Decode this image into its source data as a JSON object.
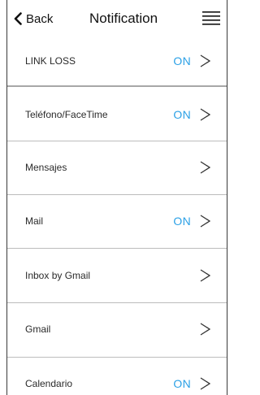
{
  "header": {
    "back_label": "Back",
    "title": "Notification",
    "back_icon": "chevron-left-icon",
    "menu_icon": "hamburger-menu-icon"
  },
  "items": [
    {
      "label": "LINK LOSS",
      "status": "ON"
    },
    {
      "label": "Teléfono/FaceTime",
      "status": "ON"
    },
    {
      "label": "Mensajes",
      "status": ""
    },
    {
      "label": "Mail",
      "status": "ON"
    },
    {
      "label": "Inbox by Gmail",
      "status": ""
    },
    {
      "label": "Gmail",
      "status": ""
    },
    {
      "label": "Calendario",
      "status": "ON"
    }
  ],
  "colors": {
    "status_on": "#2aa0e6",
    "divider": "#bcbcbc",
    "text": "#2a2a2a"
  }
}
